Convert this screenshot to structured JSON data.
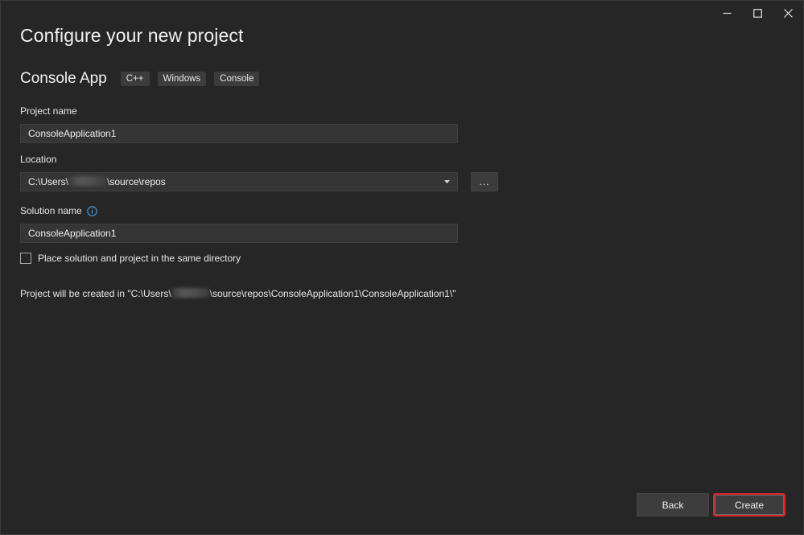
{
  "page_title": "Configure your new project",
  "template": {
    "name": "Console App",
    "tags": [
      "C++",
      "Windows",
      "Console"
    ]
  },
  "project_name": {
    "label": "Project name",
    "value": "ConsoleApplication1"
  },
  "location": {
    "label": "Location",
    "value_prefix": "C:\\Users\\",
    "value_suffix": "\\source\\repos",
    "browse_label": "..."
  },
  "solution_name": {
    "label": "Solution name",
    "value": "ConsoleApplication1"
  },
  "same_directory": {
    "label": "Place solution and project in the same directory",
    "checked": false
  },
  "created_path": {
    "prefix": "Project will be created in \"C:\\Users\\",
    "suffix": "\\source\\repos\\ConsoleApplication1\\ConsoleApplication1\\\""
  },
  "footer": {
    "back_label": "Back",
    "create_label": "Create"
  },
  "colors": {
    "background": "#262626",
    "input_background": "#353535",
    "create_highlight": "#d9262c"
  }
}
